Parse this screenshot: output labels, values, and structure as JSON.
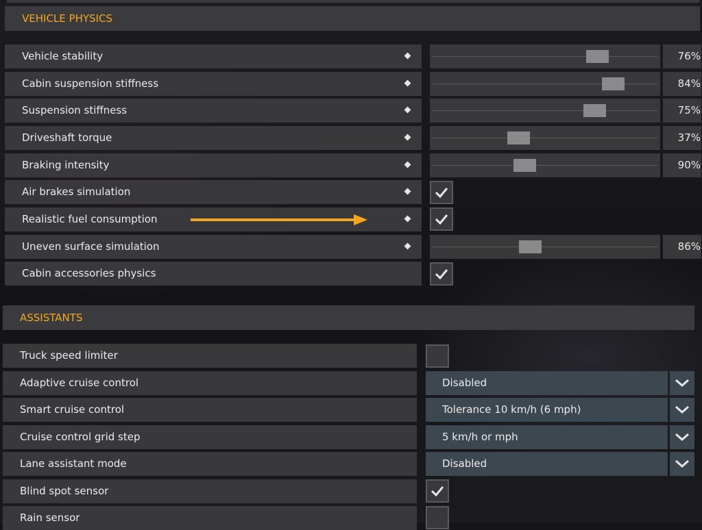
{
  "sections": {
    "vehicle_physics": "VEHICLE PHYSICS",
    "assistants": "ASSISTANTS"
  },
  "vehicle_physics": [
    {
      "label": "Vehicle stability",
      "control": "slider",
      "value": "76%",
      "level": 0.76
    },
    {
      "label": "Cabin suspension stiffness",
      "control": "slider",
      "value": "84%",
      "level": 0.84
    },
    {
      "label": "Suspension stiffness",
      "control": "slider",
      "value": "75%",
      "level": 0.75
    },
    {
      "label": "Driveshaft torque",
      "control": "slider",
      "value": "37%",
      "level": 0.37
    },
    {
      "label": "Braking intensity",
      "control": "slider",
      "value": "90%",
      "level": 0.41
    },
    {
      "label": "Air brakes simulation",
      "control": "checkbox",
      "checked": true
    },
    {
      "label": "Realistic fuel consumption",
      "control": "checkbox",
      "checked": true
    },
    {
      "label": "Uneven surface simulation",
      "control": "slider",
      "value": "86%",
      "level": 0.45
    },
    {
      "label": "Cabin accessories physics",
      "control": "checkbox",
      "checked": true
    }
  ],
  "assistants": [
    {
      "label": "Truck speed limiter",
      "control": "checkbox",
      "checked": false
    },
    {
      "label": "Adaptive cruise control",
      "control": "dropdown",
      "value": "Disabled"
    },
    {
      "label": "Smart cruise control",
      "control": "dropdown",
      "value": "Tolerance 10 km/h (6 mph)"
    },
    {
      "label": "Cruise control grid step",
      "control": "dropdown",
      "value": "5 km/h or mph"
    },
    {
      "label": "Lane assistant mode",
      "control": "dropdown",
      "value": "Disabled"
    },
    {
      "label": "Blind spot sensor",
      "control": "checkbox",
      "checked": true
    },
    {
      "label": "Rain sensor",
      "control": "checkbox",
      "checked": false
    }
  ],
  "colors": {
    "accent": "#f5a81f",
    "row_bg": "#39393b",
    "dropdown_bg": "#3d4750",
    "annotation_arrow": "#f5a81f"
  },
  "icons": {
    "row_marker": "diamond-icon",
    "checkbox_check": "checkmark-icon",
    "dropdown": "chevron-down-icon",
    "annotation": "arrow-right-icon"
  }
}
